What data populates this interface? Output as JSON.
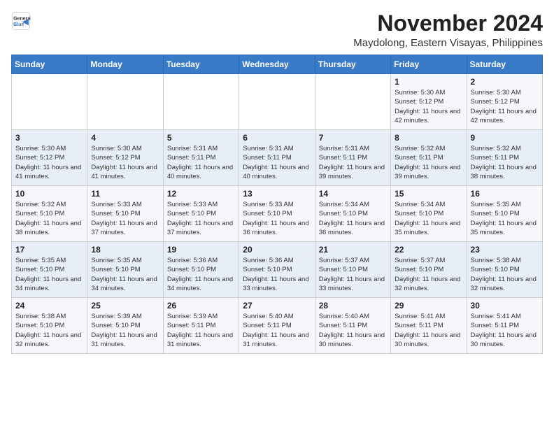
{
  "header": {
    "logo_line1": "General",
    "logo_line2": "Blue",
    "month": "November 2024",
    "location": "Maydolong, Eastern Visayas, Philippines"
  },
  "weekdays": [
    "Sunday",
    "Monday",
    "Tuesday",
    "Wednesday",
    "Thursday",
    "Friday",
    "Saturday"
  ],
  "weeks": [
    [
      {
        "day": "",
        "info": ""
      },
      {
        "day": "",
        "info": ""
      },
      {
        "day": "",
        "info": ""
      },
      {
        "day": "",
        "info": ""
      },
      {
        "day": "",
        "info": ""
      },
      {
        "day": "1",
        "info": "Sunrise: 5:30 AM\nSunset: 5:12 PM\nDaylight: 11 hours and 42 minutes."
      },
      {
        "day": "2",
        "info": "Sunrise: 5:30 AM\nSunset: 5:12 PM\nDaylight: 11 hours and 42 minutes."
      }
    ],
    [
      {
        "day": "3",
        "info": "Sunrise: 5:30 AM\nSunset: 5:12 PM\nDaylight: 11 hours and 41 minutes."
      },
      {
        "day": "4",
        "info": "Sunrise: 5:30 AM\nSunset: 5:12 PM\nDaylight: 11 hours and 41 minutes."
      },
      {
        "day": "5",
        "info": "Sunrise: 5:31 AM\nSunset: 5:11 PM\nDaylight: 11 hours and 40 minutes."
      },
      {
        "day": "6",
        "info": "Sunrise: 5:31 AM\nSunset: 5:11 PM\nDaylight: 11 hours and 40 minutes."
      },
      {
        "day": "7",
        "info": "Sunrise: 5:31 AM\nSunset: 5:11 PM\nDaylight: 11 hours and 39 minutes."
      },
      {
        "day": "8",
        "info": "Sunrise: 5:32 AM\nSunset: 5:11 PM\nDaylight: 11 hours and 39 minutes."
      },
      {
        "day": "9",
        "info": "Sunrise: 5:32 AM\nSunset: 5:11 PM\nDaylight: 11 hours and 38 minutes."
      }
    ],
    [
      {
        "day": "10",
        "info": "Sunrise: 5:32 AM\nSunset: 5:10 PM\nDaylight: 11 hours and 38 minutes."
      },
      {
        "day": "11",
        "info": "Sunrise: 5:33 AM\nSunset: 5:10 PM\nDaylight: 11 hours and 37 minutes."
      },
      {
        "day": "12",
        "info": "Sunrise: 5:33 AM\nSunset: 5:10 PM\nDaylight: 11 hours and 37 minutes."
      },
      {
        "day": "13",
        "info": "Sunrise: 5:33 AM\nSunset: 5:10 PM\nDaylight: 11 hours and 36 minutes."
      },
      {
        "day": "14",
        "info": "Sunrise: 5:34 AM\nSunset: 5:10 PM\nDaylight: 11 hours and 36 minutes."
      },
      {
        "day": "15",
        "info": "Sunrise: 5:34 AM\nSunset: 5:10 PM\nDaylight: 11 hours and 35 minutes."
      },
      {
        "day": "16",
        "info": "Sunrise: 5:35 AM\nSunset: 5:10 PM\nDaylight: 11 hours and 35 minutes."
      }
    ],
    [
      {
        "day": "17",
        "info": "Sunrise: 5:35 AM\nSunset: 5:10 PM\nDaylight: 11 hours and 34 minutes."
      },
      {
        "day": "18",
        "info": "Sunrise: 5:35 AM\nSunset: 5:10 PM\nDaylight: 11 hours and 34 minutes."
      },
      {
        "day": "19",
        "info": "Sunrise: 5:36 AM\nSunset: 5:10 PM\nDaylight: 11 hours and 34 minutes."
      },
      {
        "day": "20",
        "info": "Sunrise: 5:36 AM\nSunset: 5:10 PM\nDaylight: 11 hours and 33 minutes."
      },
      {
        "day": "21",
        "info": "Sunrise: 5:37 AM\nSunset: 5:10 PM\nDaylight: 11 hours and 33 minutes."
      },
      {
        "day": "22",
        "info": "Sunrise: 5:37 AM\nSunset: 5:10 PM\nDaylight: 11 hours and 32 minutes."
      },
      {
        "day": "23",
        "info": "Sunrise: 5:38 AM\nSunset: 5:10 PM\nDaylight: 11 hours and 32 minutes."
      }
    ],
    [
      {
        "day": "24",
        "info": "Sunrise: 5:38 AM\nSunset: 5:10 PM\nDaylight: 11 hours and 32 minutes."
      },
      {
        "day": "25",
        "info": "Sunrise: 5:39 AM\nSunset: 5:10 PM\nDaylight: 11 hours and 31 minutes."
      },
      {
        "day": "26",
        "info": "Sunrise: 5:39 AM\nSunset: 5:11 PM\nDaylight: 11 hours and 31 minutes."
      },
      {
        "day": "27",
        "info": "Sunrise: 5:40 AM\nSunset: 5:11 PM\nDaylight: 11 hours and 31 minutes."
      },
      {
        "day": "28",
        "info": "Sunrise: 5:40 AM\nSunset: 5:11 PM\nDaylight: 11 hours and 30 minutes."
      },
      {
        "day": "29",
        "info": "Sunrise: 5:41 AM\nSunset: 5:11 PM\nDaylight: 11 hours and 30 minutes."
      },
      {
        "day": "30",
        "info": "Sunrise: 5:41 AM\nSunset: 5:11 PM\nDaylight: 11 hours and 30 minutes."
      }
    ]
  ]
}
